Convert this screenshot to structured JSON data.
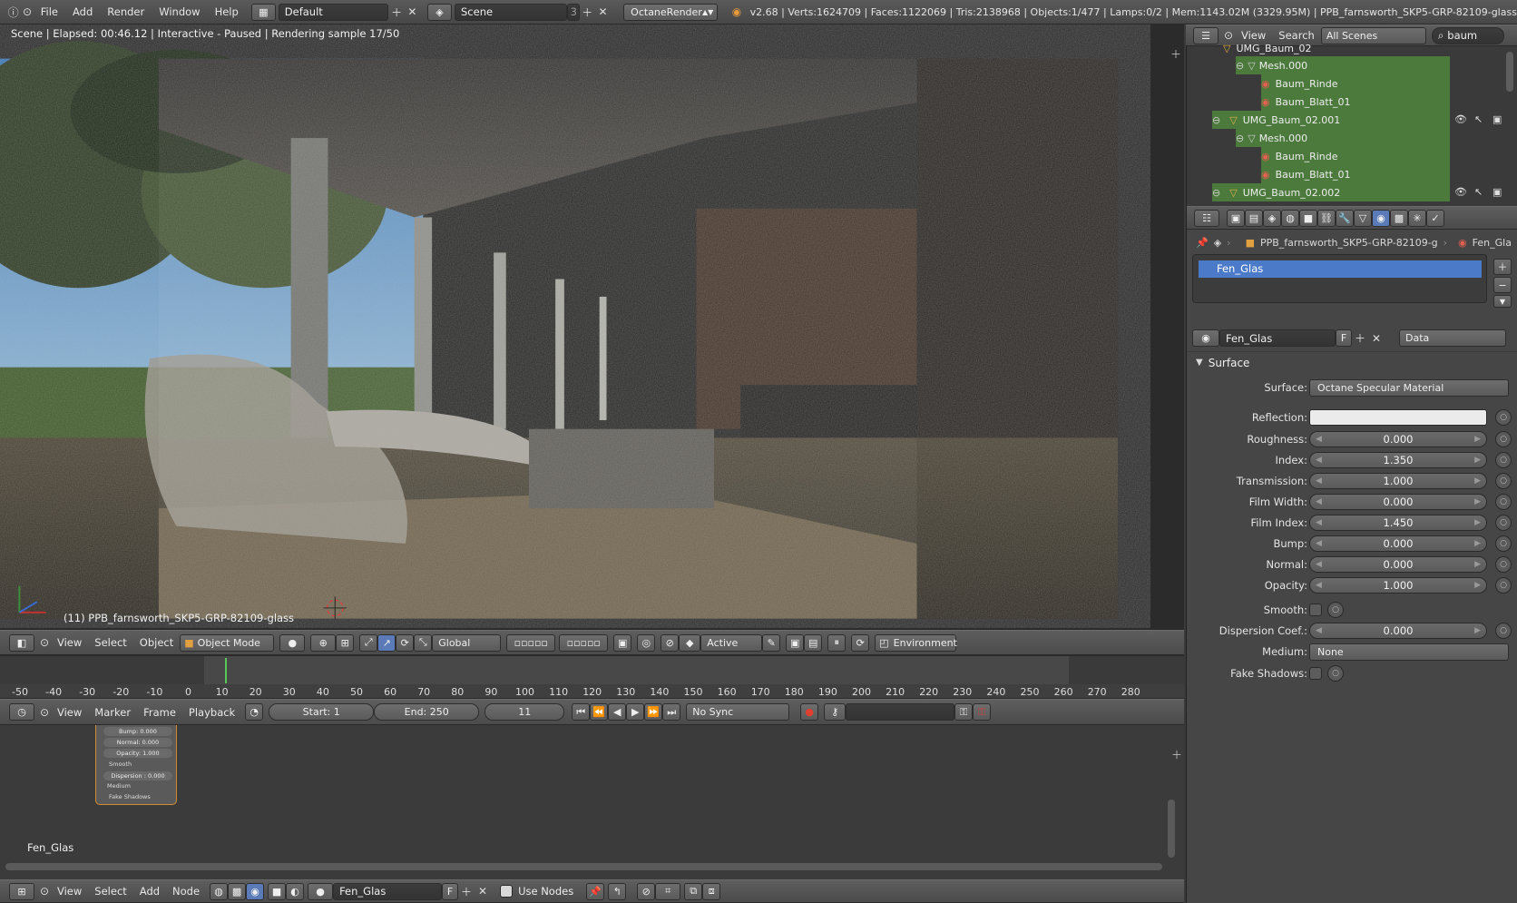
{
  "topbar": {
    "menus": [
      "File",
      "Add",
      "Render",
      "Window",
      "Help"
    ],
    "layout": "Default",
    "scene": "Scene",
    "scene_users": "3",
    "engine": "OctaneRender",
    "stats": "v2.68 | Verts:1624709 | Faces:1122069 | Tris:2138968 | Objects:1/477 | Lamps:0/2 | Mem:1143.02M (3329.95M) | PPB_farnsworth_SKP5-GRP-82109-glass"
  },
  "viewport": {
    "status": "Scene | Elapsed: 00:46.12 | Interactive - Paused | Rendering sample 17/50",
    "object_label": "(11) PPB_farnsworth_SKP5-GRP-82109-glass"
  },
  "view3d_header": {
    "menus": [
      "View",
      "Select",
      "Object"
    ],
    "mode": "Object Mode",
    "orientation": "Global",
    "snap_target": "Active",
    "env_label": "Environment"
  },
  "timeline": {
    "ticks": [
      "-50",
      "-40",
      "-30",
      "-20",
      "-10",
      "0",
      "10",
      "20",
      "30",
      "40",
      "50",
      "60",
      "70",
      "80",
      "90",
      "100",
      "110",
      "120",
      "130",
      "140",
      "150",
      "160",
      "170",
      "180",
      "190",
      "200",
      "210",
      "220",
      "230",
      "240",
      "250",
      "260",
      "270",
      "280"
    ],
    "menus": [
      "View",
      "Marker",
      "Frame",
      "Playback"
    ],
    "start": "Start: 1",
    "end": "End: 250",
    "current": "11",
    "sync": "No Sync",
    "current_frame": 11
  },
  "node_editor": {
    "node_rows": [
      "Bump: 0.000",
      "Normal: 0.000",
      "Opacity: 1.000",
      "Smooth",
      "Dispersion : 0.000",
      "Medium",
      "Fake Shadows"
    ],
    "material_label": "Fen_Glas",
    "header_menus": [
      "View",
      "Select",
      "Add",
      "Node"
    ],
    "material_field": "Fen_Glas",
    "fake_user": "F",
    "use_nodes_label": "Use Nodes"
  },
  "outliner": {
    "header_menus": [
      "View",
      "Search"
    ],
    "scene_filter": "All Scenes",
    "search": "baum",
    "rows": [
      {
        "label": "UMG_Baum_02"
      },
      {
        "label": "Mesh.000"
      },
      {
        "label": "Baum_Rinde"
      },
      {
        "label": "Baum_Blatt_01"
      },
      {
        "label": "UMG_Baum_02.001"
      },
      {
        "label": "Mesh.000"
      },
      {
        "label": "Baum_Rinde"
      },
      {
        "label": "Baum_Blatt_01"
      },
      {
        "label": "UMG_Baum_02.002"
      }
    ]
  },
  "properties": {
    "breadcrumb_object": "PPB_farnsworth_SKP5-GRP-82109-g",
    "breadcrumb_material": "Fen_Gla",
    "slot_list": [
      "Fen_Glas"
    ],
    "material_name": "Fen_Glas",
    "fake_user": "F",
    "link_dropdown": "Data",
    "panel_title": "Surface",
    "surface_label": "Surface:",
    "surface_value": "Octane Specular Material",
    "reflection_label": "Reflection:",
    "fields": [
      {
        "label": "Roughness:",
        "value": "0.000"
      },
      {
        "label": "Index:",
        "value": "1.350"
      },
      {
        "label": "Transmission:",
        "value": "1.000"
      },
      {
        "label": "Film Width:",
        "value": "0.000"
      },
      {
        "label": "Film Index:",
        "value": "1.450"
      },
      {
        "label": "Bump:",
        "value": "0.000"
      },
      {
        "label": "Normal:",
        "value": "0.000"
      },
      {
        "label": "Opacity:",
        "value": "1.000"
      }
    ],
    "smooth_label": "Smooth:",
    "dispersion_label": "Dispersion Coef.:",
    "dispersion_value": "0.000",
    "medium_label": "Medium:",
    "medium_value": "None",
    "fake_shadows_label": "Fake Shadows:"
  }
}
